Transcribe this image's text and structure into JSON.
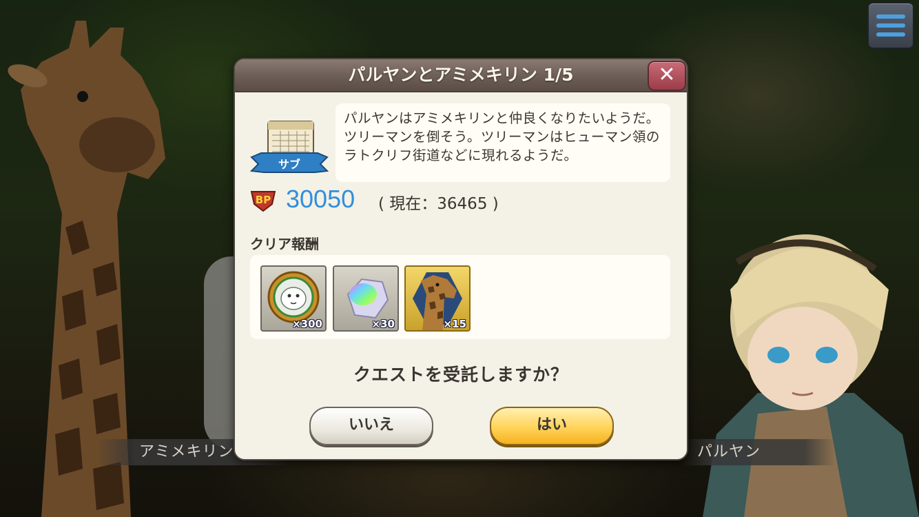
{
  "scene": {
    "left_character_name": "アミメキリン",
    "right_character_name": "パルヤン"
  },
  "menu": {
    "icon": "hamburger-menu-icon"
  },
  "dialog": {
    "title": "パルヤンとアミメキリン 1/5",
    "close_icon": "close-x-icon",
    "quest_type_badge": "サブ",
    "description": "パルヤンはアミメキリンと仲良くなりたいようだ。ツリーマンを倒そう。ツリーマンはヒューマン領のラトクリフ街道などに現れるようだ。",
    "bp_label": "BP",
    "bp_required": "30050",
    "bp_current": "( 現在：36465 )",
    "reward_label": "クリア報酬",
    "rewards": [
      {
        "icon": "white-tiger-medal-icon",
        "quantity": "×300"
      },
      {
        "icon": "rainbow-crystal-icon",
        "quantity": "×30"
      },
      {
        "icon": "giraffe-portrait-icon",
        "quantity": "×15"
      }
    ],
    "question": "クエストを受託しますか？",
    "no_button": "いいえ",
    "yes_button": "はい"
  },
  "colors": {
    "accent_blue": "#2f8fdc",
    "yes_button": "#ffd35a",
    "close_button": "#b0505c",
    "panel": "#f4f1e6"
  }
}
